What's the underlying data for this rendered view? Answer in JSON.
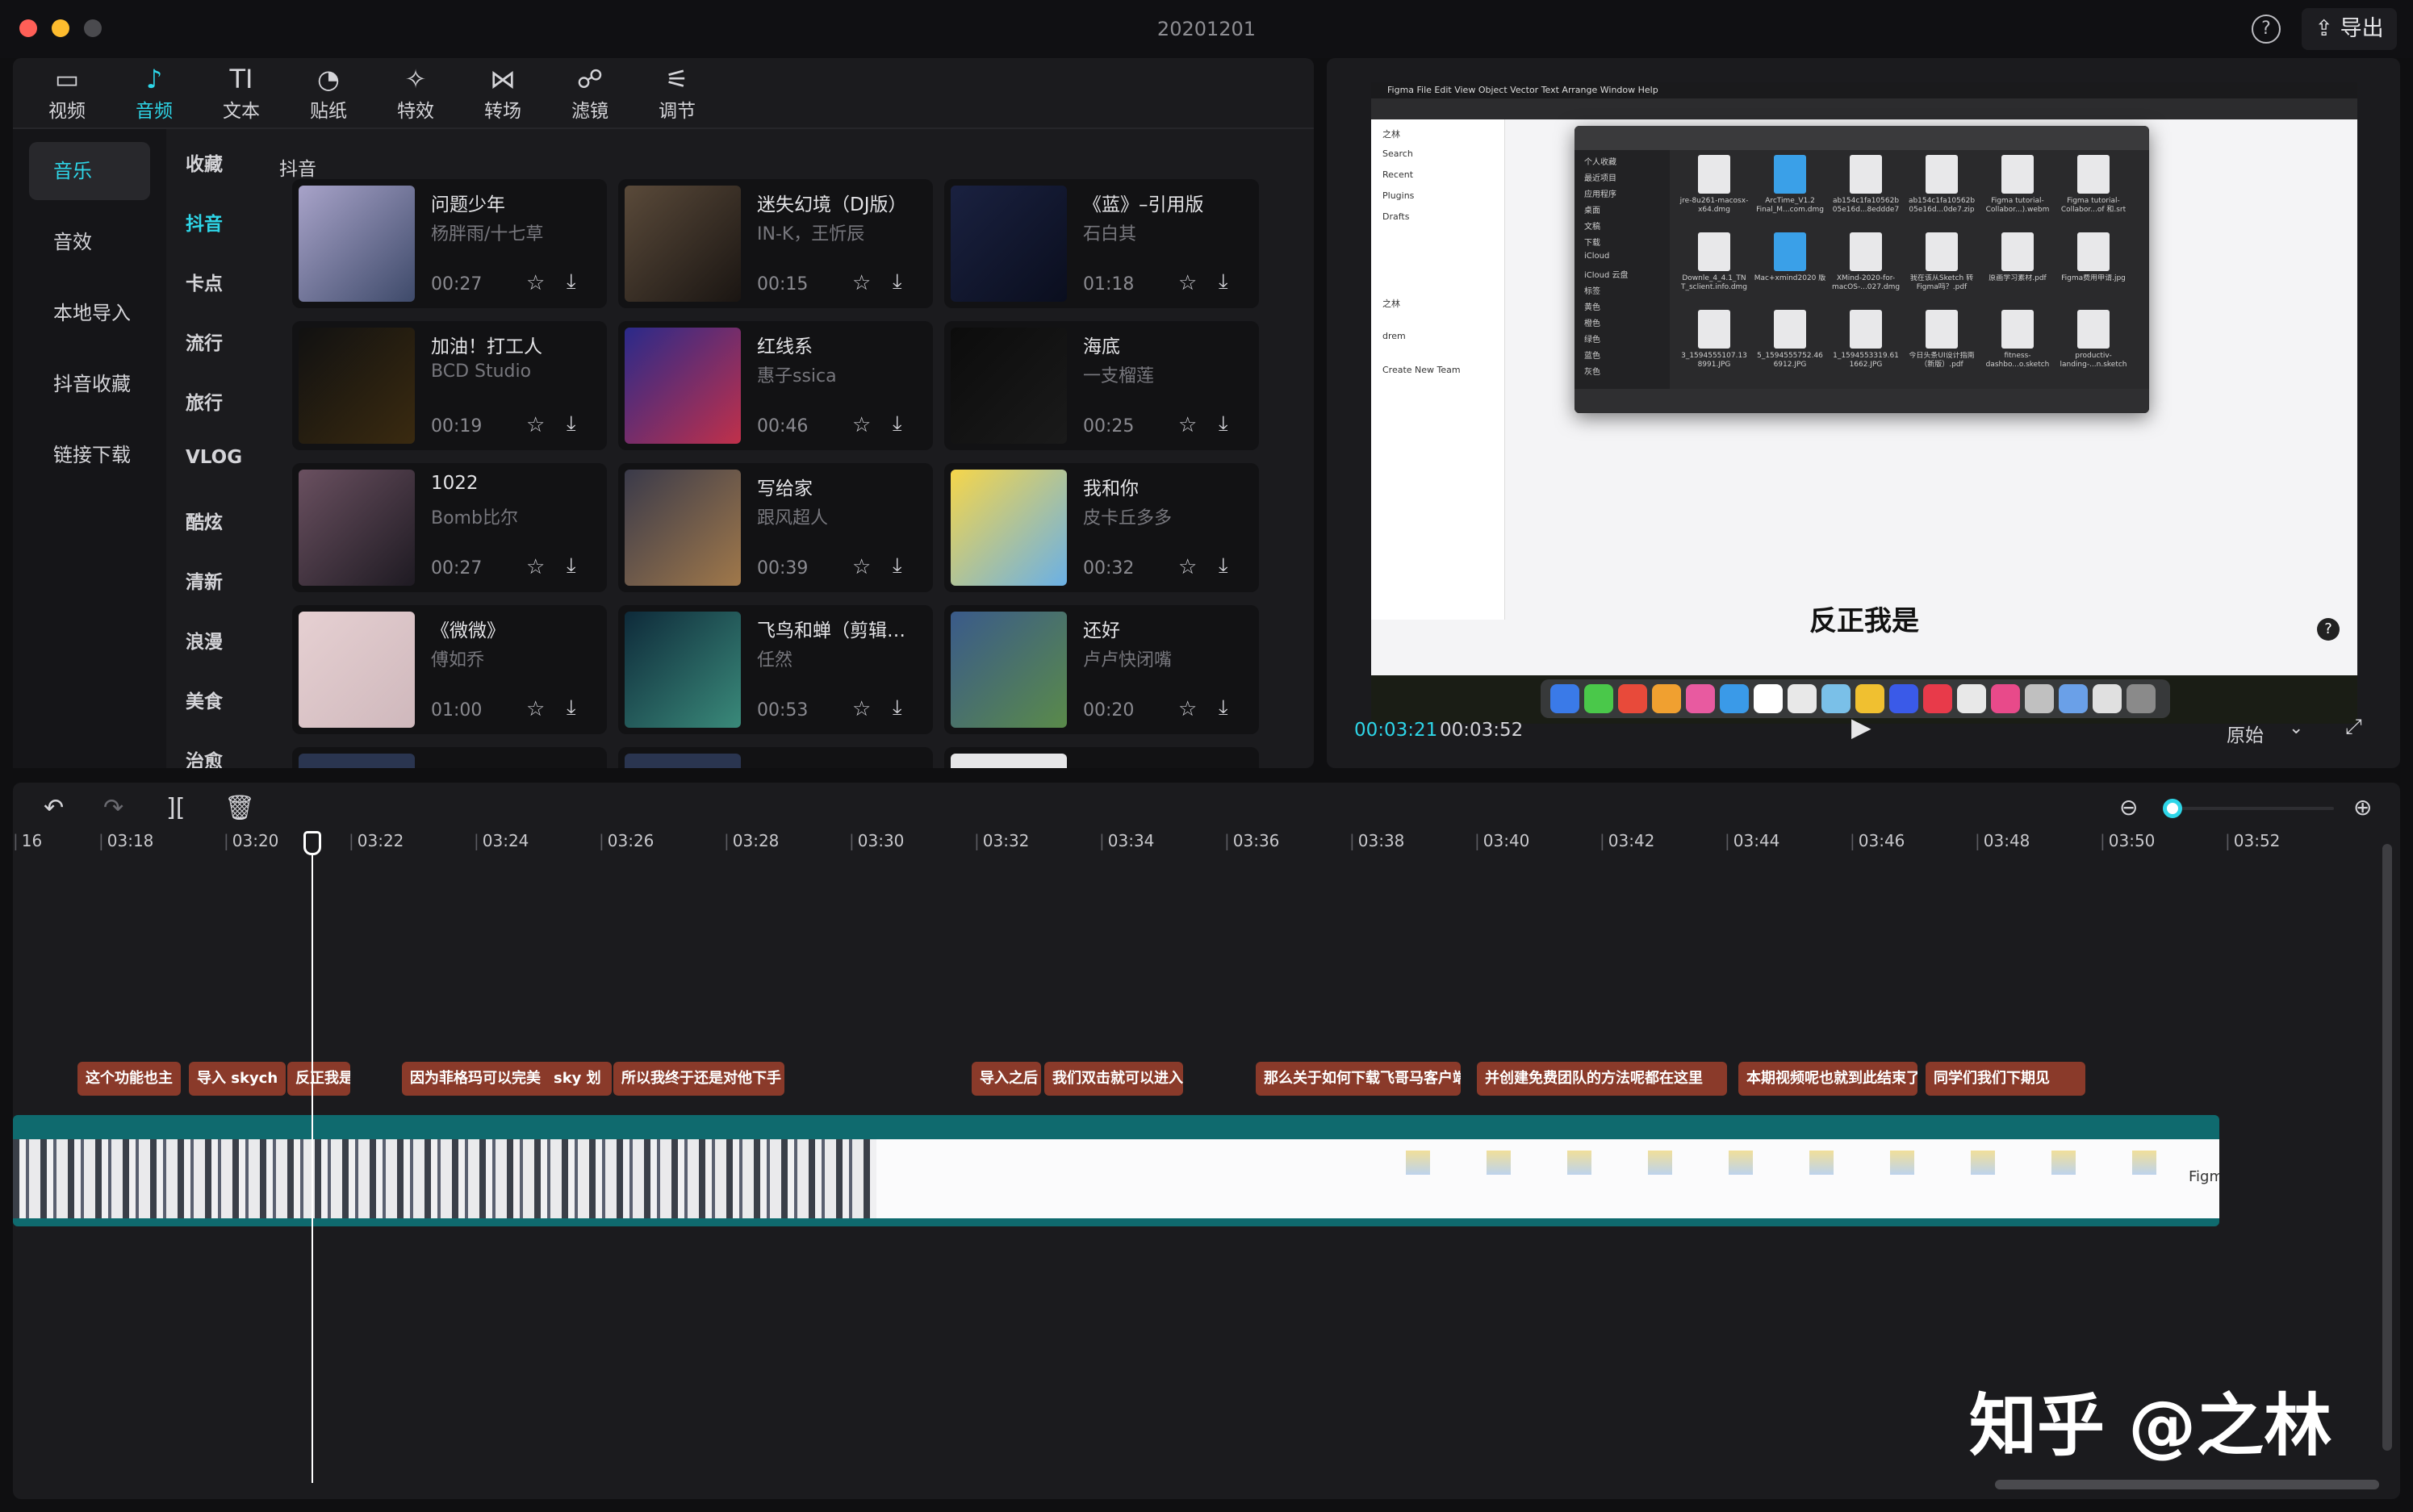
{
  "window": {
    "title": "20201201",
    "export_label": "导出",
    "help": "?"
  },
  "tabs": [
    {
      "icon": "video-icon",
      "glyph": "▭",
      "label": "视频"
    },
    {
      "icon": "music-note-icon",
      "glyph": "♪",
      "label": "音频"
    },
    {
      "icon": "text-icon",
      "glyph": "TI",
      "label": "文本"
    },
    {
      "icon": "sticker-icon",
      "glyph": "◔",
      "label": "贴纸"
    },
    {
      "icon": "sparkle-icon",
      "glyph": "✧",
      "label": "特效"
    },
    {
      "icon": "transition-icon",
      "glyph": "⋈",
      "label": "转场"
    },
    {
      "icon": "filter-icon",
      "glyph": "☍",
      "label": "滤镜"
    },
    {
      "icon": "adjust-icon",
      "glyph": "⚟",
      "label": "调节"
    }
  ],
  "nav": [
    "音乐",
    "音效",
    "本地导入",
    "抖音收藏",
    "链接下载"
  ],
  "subnav": [
    "收藏",
    "抖音",
    "卡点",
    "流行",
    "旅行",
    "VLOG",
    "酷炫",
    "清新",
    "浪漫",
    "美食",
    "治愈"
  ],
  "category_title": "抖音",
  "songs": [
    {
      "title": "问题少年",
      "artist": "杨胖雨/十七草",
      "duration": "00:27",
      "c1": "#a8a3c9",
      "c2": "#3e4a6a"
    },
    {
      "title": "迷失幻境（DJ版）",
      "artist": "IN-K，王忻辰",
      "duration": "00:15",
      "c1": "#5a4a3a",
      "c2": "#1a1512"
    },
    {
      "title": "《蓝》–引用版",
      "artist": "石白其",
      "duration": "01:18",
      "c1": "#1a2140",
      "c2": "#0a0e1e"
    },
    {
      "title": "加油！打工人",
      "artist": "BCD Studio",
      "duration": "00:19",
      "c1": "#111111",
      "c2": "#3a2a10"
    },
    {
      "title": "红线系",
      "artist": "惠子ssica",
      "duration": "00:46",
      "c1": "#2a2a8a",
      "c2": "#c0304a"
    },
    {
      "title": "海底",
      "artist": "一支榴莲",
      "duration": "00:25",
      "c1": "#0c0c0c",
      "c2": "#1a1a1a"
    },
    {
      "title": "1022",
      "artist": "Bomb比尔",
      "duration": "00:27",
      "c1": "#6a5060",
      "c2": "#1e1a22"
    },
    {
      "title": "写给家",
      "artist": "跟风超人",
      "duration": "00:39",
      "c1": "#3a3a4a",
      "c2": "#a0784a"
    },
    {
      "title": "我和你",
      "artist": "皮卡丘多多",
      "duration": "00:32",
      "c1": "#f6d64a",
      "c2": "#6ab0e6"
    },
    {
      "title": "《微微》",
      "artist": "傅如乔",
      "duration": "01:00",
      "c1": "#e6d0d2",
      "c2": "#cfb8bc"
    },
    {
      "title": "飞鸟和蝉（剪辑…",
      "artist": "任然",
      "duration": "00:53",
      "c1": "#0e2a3a",
      "c2": "#3a8a7a"
    },
    {
      "title": "还好",
      "artist": "卢卢快闭嘴",
      "duration": "00:20",
      "c1": "#3a5a8a",
      "c2": "#5a8a4a"
    }
  ],
  "preview": {
    "time_current": "00:03:21",
    "time_total": "00:03:52",
    "ratio_label": "原始",
    "subtitle": "反正我是",
    "menubar": "Figma   File   Edit   View   Object   Vector   Text   Arrange   Window   Help",
    "fig_sidebar": [
      "之林",
      "Search",
      "Recent",
      "Plugins",
      "Drafts",
      "之林",
      "drem",
      "Create New Team"
    ],
    "finder_sidebar": [
      "个人收藏",
      "最近项目",
      "应用程序",
      "桌面",
      "文稿",
      "下载",
      "iCloud",
      "iCloud 云盘",
      "标签",
      "黄色",
      "橙色",
      "绿色",
      "蓝色",
      "灰色"
    ],
    "finder_files": [
      "jre-8u261-macosx-x64.dmg",
      "ArcTime_V1.2 Final_M...com.dmg",
      "ab154c1fa10562b 05e16d...8eddde7",
      "ab154c1fa10562b 05e16d...0de7.zip",
      "Figma tutorial-Collabor...).webm",
      "Figma tutorial-Collabor...of 和.srt",
      "Downle_4_4.1_TN T_sclient.info.dmg",
      "Mac+xmind2020 版",
      "XMind-2020-for-macOS-...027.dmg",
      "我在该从Sketch 转 Figma吗？.pdf",
      "原画学习素材.pdf",
      "Figma费用申请.jpg",
      "3_1594555107.13 8991.JPG",
      "5_1594555752.46 6912.JPG",
      "1_1594553319.61 1662.JPG",
      "今日头条UI设计指南（新版）.pdf",
      "fitness-dashbo...o.sketch",
      "productiv-landing-...n.sketch"
    ]
  },
  "timeline": {
    "ticks": [
      "16",
      "03:18",
      "03:20",
      "03:22",
      "03:24",
      "03:26",
      "03:28",
      "03:30",
      "03:32",
      "03:34",
      "03:36",
      "03:38",
      "03:40",
      "03:42",
      "03:44",
      "03:46",
      "03:48",
      "03:50",
      "03:52"
    ],
    "subtitles": [
      "这个功能也主",
      "导入 skych",
      "反正我是",
      "因为菲格玛可以完美",
      "sky 划",
      "所以我终于还是对他下手",
      "导入之后",
      "我们双击就可以进入",
      "那么关于如何下载飞哥马客户端",
      "并创建免费团队的方法呢都在这里",
      "本期视频呢也就到此结束了",
      "同学们我们下期见"
    ],
    "clip_label": "Figm"
  },
  "watermark": "知乎 @之林"
}
